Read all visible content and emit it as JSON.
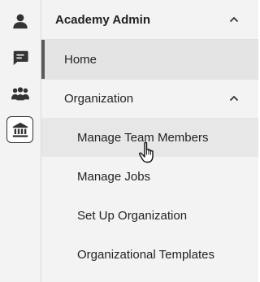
{
  "rail": {
    "items": [
      {
        "icon": "person-icon",
        "active": false
      },
      {
        "icon": "chat-icon",
        "active": false
      },
      {
        "icon": "team-icon",
        "active": false
      },
      {
        "icon": "institution-icon",
        "active": true
      }
    ]
  },
  "menu": {
    "section_title": "Academy Admin",
    "section_expanded": true,
    "home_label": "Home",
    "organization_label": "Organization",
    "organization_expanded": true,
    "sub_items": [
      {
        "label": "Manage Team Members",
        "hovered": true
      },
      {
        "label": "Manage Jobs",
        "hovered": false
      },
      {
        "label": "Set Up Organization",
        "hovered": false
      },
      {
        "label": "Organizational Templates",
        "hovered": false
      }
    ]
  },
  "colors": {
    "rail_background": "#f3f3f3",
    "panel_background": "#f3f3f3",
    "active_row_background": "#e4e4e4",
    "active_indicator": "#5a5a5a",
    "icon_color": "#333333",
    "text_color": "#222222"
  }
}
